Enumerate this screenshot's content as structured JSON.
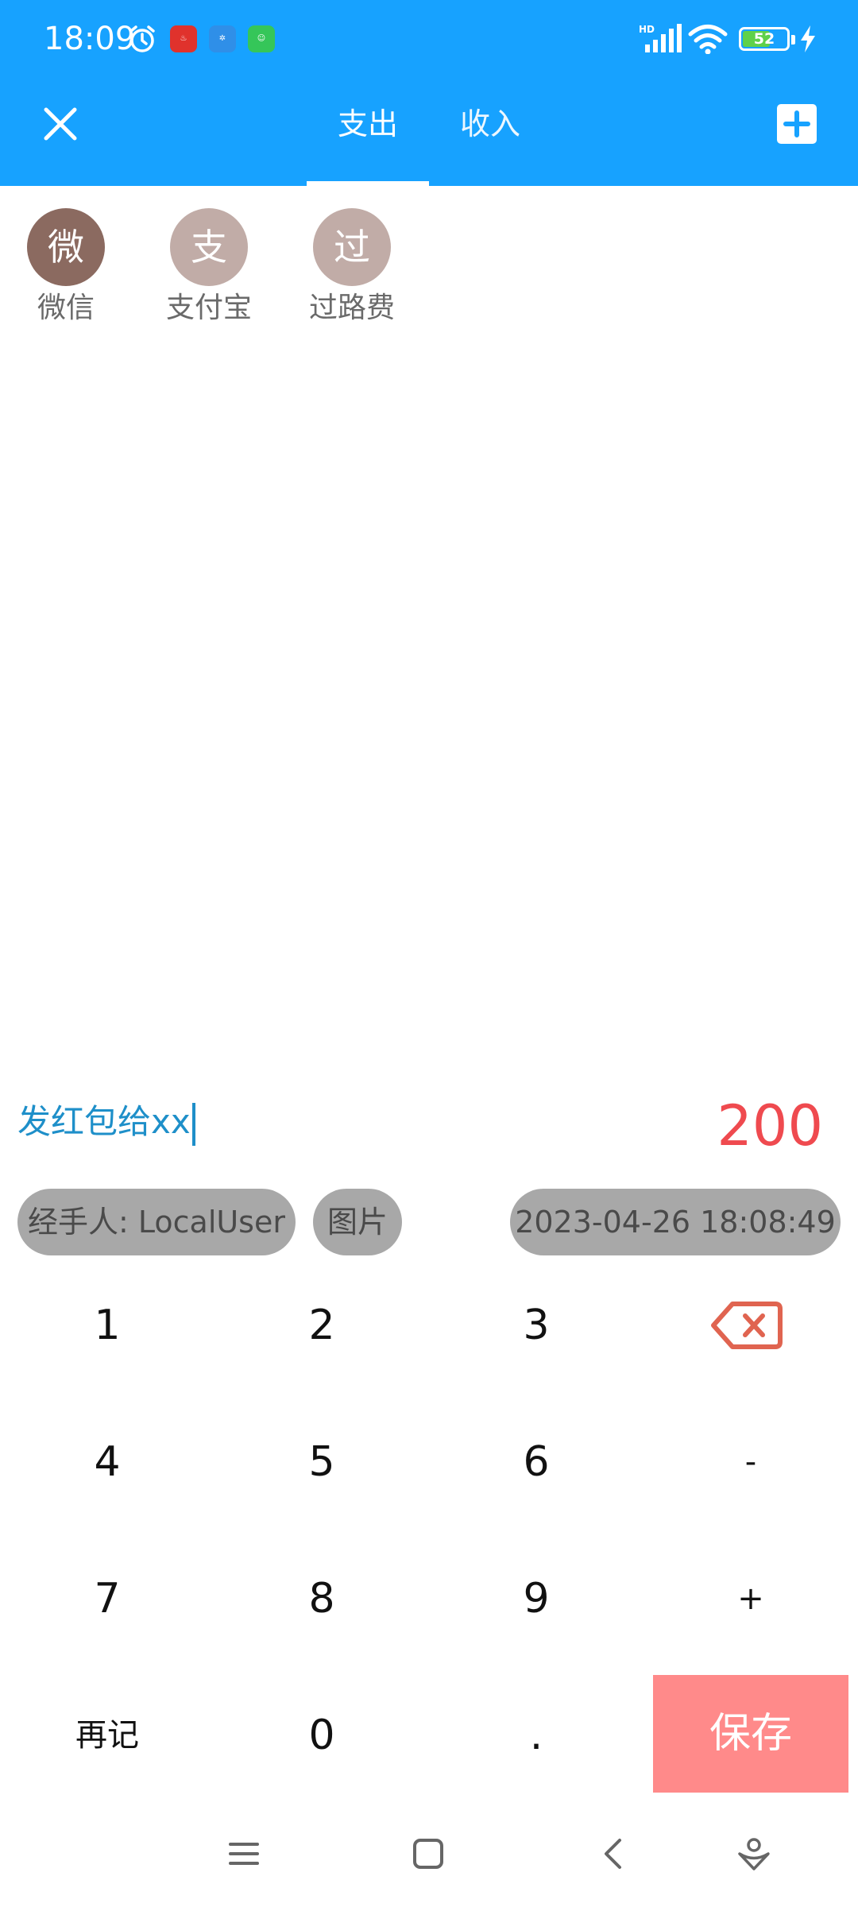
{
  "status_bar": {
    "time": "18:09",
    "network": "HD",
    "battery": "52",
    "app_icons": [
      "app-icon-red",
      "app-icon-blue",
      "app-icon-green"
    ]
  },
  "toolbar": {
    "tabs": [
      {
        "label": "支出",
        "active": true
      },
      {
        "label": "收入",
        "active": false
      }
    ],
    "accent_color": "#17a2ff"
  },
  "categories": [
    {
      "icon_text": "微",
      "label": "微信",
      "color": "#8b6a60"
    },
    {
      "icon_text": "支",
      "label": "支付宝",
      "color": "#c1aca7"
    },
    {
      "icon_text": "过",
      "label": "过路费",
      "color": "#c1aca7"
    }
  ],
  "entry": {
    "note": "发红包给xx",
    "amount": "200",
    "amount_color": "#ef4a4f"
  },
  "chips": {
    "handler": "经手人: LocalUser",
    "image": "图片",
    "datetime": "2023-04-26 18:08:49"
  },
  "keypad": {
    "row1": [
      "1",
      "2",
      "3"
    ],
    "row2": [
      "4",
      "5",
      "6",
      "-"
    ],
    "row3": [
      "7",
      "8",
      "9",
      "+"
    ],
    "row4": [
      "再记",
      "0",
      "."
    ],
    "backspace_icon": "backspace-icon",
    "save": "保存",
    "save_color": "#ff8a8a"
  }
}
